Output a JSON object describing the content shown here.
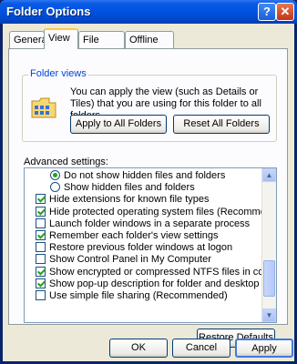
{
  "window": {
    "title": "Folder Options"
  },
  "tabs": [
    "General",
    "View",
    "File Types",
    "Offline Files"
  ],
  "folder_views": {
    "label": "Folder views",
    "description": "You can apply the view (such as Details or Tiles) that you are using for this folder to all folders.",
    "apply_button": "Apply to All Folders",
    "reset_button": "Reset All Folders"
  },
  "advanced": {
    "label": "Advanced settings:",
    "items": [
      {
        "type": "radio",
        "checked": true,
        "label": "Do not show hidden files and folders"
      },
      {
        "type": "radio",
        "checked": false,
        "label": "Show hidden files and folders"
      },
      {
        "type": "check",
        "checked": true,
        "label": "Hide extensions for known file types"
      },
      {
        "type": "check",
        "checked": true,
        "label": "Hide protected operating system files (Recommended)"
      },
      {
        "type": "check",
        "checked": false,
        "label": "Launch folder windows in a separate process"
      },
      {
        "type": "check",
        "checked": true,
        "label": "Remember each folder's view settings"
      },
      {
        "type": "check",
        "checked": false,
        "label": "Restore previous folder windows at logon"
      },
      {
        "type": "check",
        "checked": false,
        "label": "Show Control Panel in My Computer"
      },
      {
        "type": "check",
        "checked": true,
        "label": "Show encrypted or compressed NTFS files in color"
      },
      {
        "type": "check",
        "checked": true,
        "label": "Show pop-up description for folder and desktop items"
      },
      {
        "type": "check",
        "checked": false,
        "label": "Use simple file sharing (Recommended)"
      }
    ]
  },
  "restore_button": "Restore Defaults",
  "footer": {
    "ok": "OK",
    "cancel": "Cancel",
    "apply": "Apply"
  }
}
